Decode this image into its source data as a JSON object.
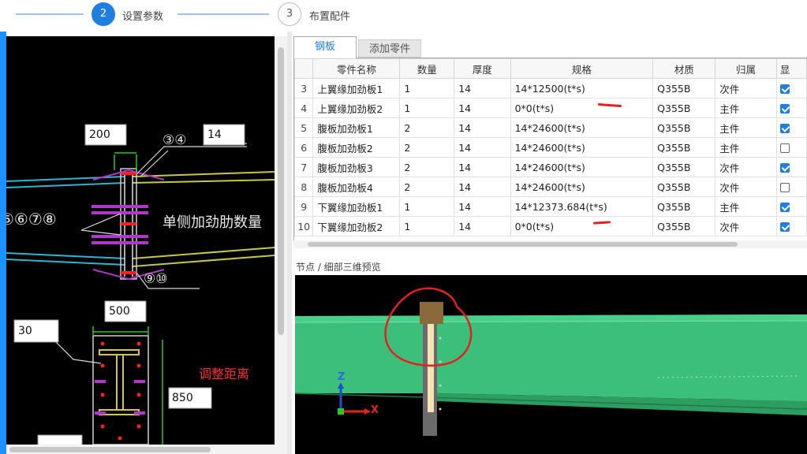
{
  "stepper": {
    "steps": [
      {
        "number": "2",
        "label": "设置参数",
        "state": "active"
      },
      {
        "number": "3",
        "label": "布置配件",
        "state": "inactive"
      }
    ]
  },
  "cad": {
    "labels": {
      "width_top": "200",
      "thickness_top": "14",
      "callout_top": "③④",
      "callout_left": "⑤⑥⑦⑧",
      "callout_bottom": "⑨⑩",
      "note": "单侧加劲肋数量",
      "width_bottom": "500",
      "left_value": "30",
      "height_value": "850"
    },
    "annotation": "调整距离"
  },
  "tabs": [
    {
      "label": "钢板",
      "active": true
    },
    {
      "label": "添加零件",
      "active": false
    }
  ],
  "table": {
    "columns": [
      "",
      "零件名称",
      "数量",
      "厚度",
      "规格",
      "材质",
      "归属",
      "显"
    ],
    "rows": [
      {
        "no": "3",
        "name": "上翼缘加劲板1",
        "qty": "1",
        "thick": "14",
        "spec": "14*12500(t*s)",
        "material": "Q355B",
        "belong": "次件",
        "show": true
      },
      {
        "no": "4",
        "name": "上翼缘加劲板2",
        "qty": "1",
        "thick": "14",
        "spec": "0*0(t*s)",
        "material": "Q355B",
        "belong": "主件",
        "show": true
      },
      {
        "no": "5",
        "name": "腹板加劲板1",
        "qty": "2",
        "thick": "14",
        "spec": "14*24600(t*s)",
        "material": "Q355B",
        "belong": "主件",
        "show": true
      },
      {
        "no": "6",
        "name": "腹板加劲板2",
        "qty": "2",
        "thick": "14",
        "spec": "14*24600(t*s)",
        "material": "Q355B",
        "belong": "主件",
        "show": false
      },
      {
        "no": "7",
        "name": "腹板加劲板3",
        "qty": "2",
        "thick": "14",
        "spec": "14*24600(t*s)",
        "material": "Q355B",
        "belong": "次件",
        "show": true
      },
      {
        "no": "8",
        "name": "腹板加劲板4",
        "qty": "2",
        "thick": "14",
        "spec": "14*24600(t*s)",
        "material": "Q355B",
        "belong": "次件",
        "show": false
      },
      {
        "no": "9",
        "name": "下翼缘加劲板1",
        "qty": "1",
        "thick": "14",
        "spec": "14*12373.684(t*s)",
        "material": "Q355B",
        "belong": "主件",
        "show": true
      },
      {
        "no": "10",
        "name": "下翼缘加劲板2",
        "qty": "1",
        "thick": "14",
        "spec": "0*0(t*s)",
        "material": "Q355B",
        "belong": "次件",
        "show": true
      }
    ]
  },
  "preview": {
    "title": "节点 / 细部三维预览",
    "axis_z": "Z",
    "axis_x": "X"
  },
  "colors": {
    "accent": "#1f7fe0",
    "beam_green": "#3cbf7a",
    "markup_red": "#e52020"
  }
}
